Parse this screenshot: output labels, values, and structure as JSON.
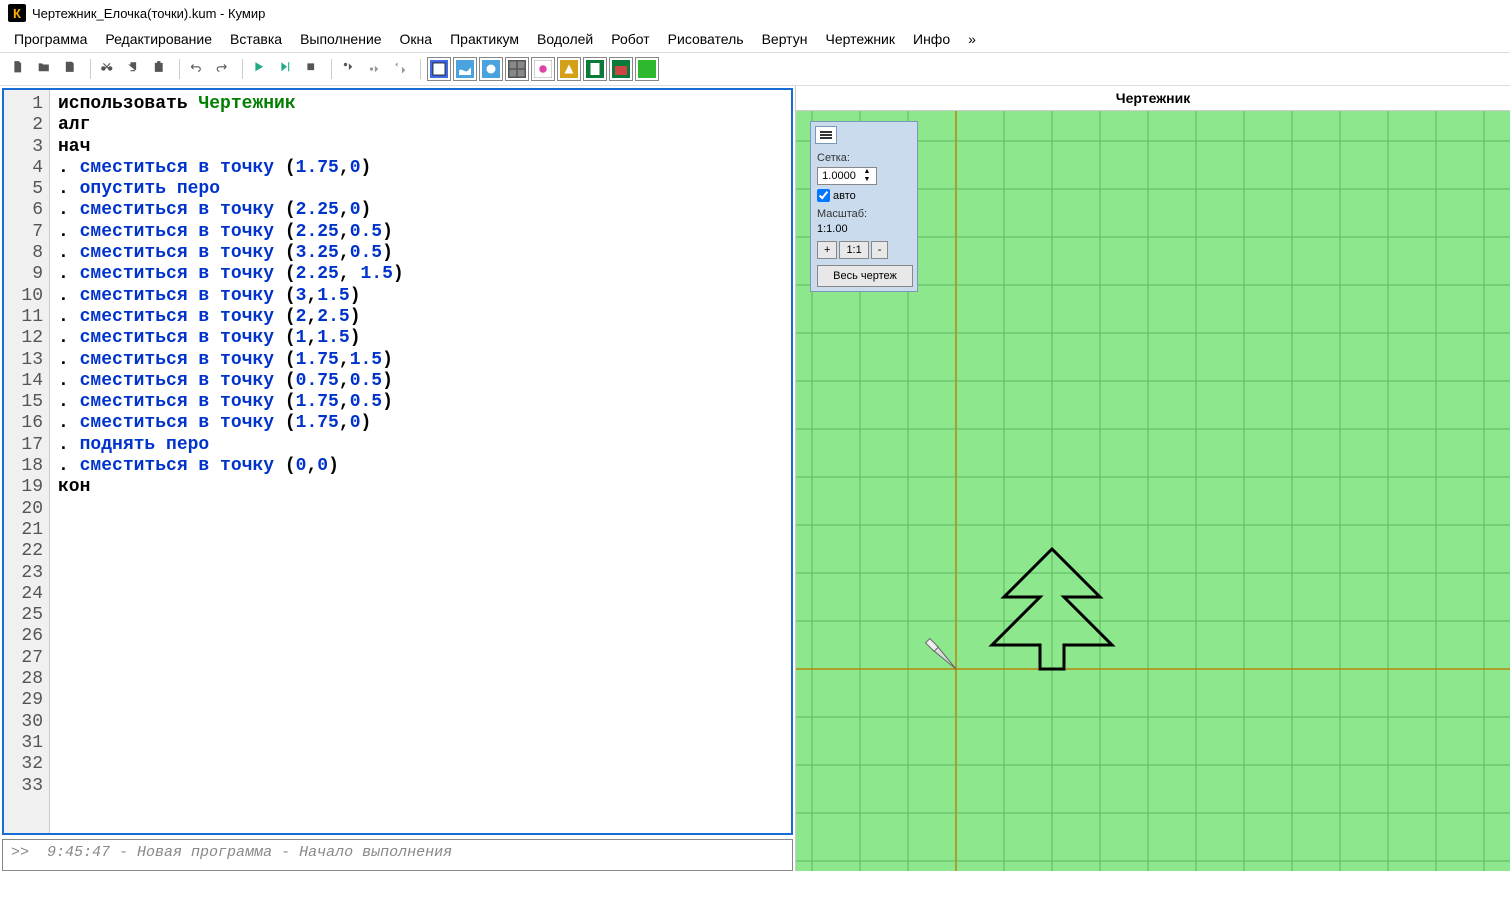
{
  "title": "Чертежник_Елочка(точки).kum - Кумир",
  "menu": [
    "Программа",
    "Редактирование",
    "Вставка",
    "Выполнение",
    "Окна",
    "Практикум",
    "Водолей",
    "Робот",
    "Рисователь",
    "Вертун",
    "Чертежник",
    "Инфо",
    "»"
  ],
  "gutter_max": 33,
  "code_lines": [
    {
      "tokens": [
        {
          "t": "использовать ",
          "c": "kw"
        },
        {
          "t": "Чертежник",
          "c": "mod"
        }
      ]
    },
    {
      "tokens": [
        {
          "t": "алг",
          "c": "kw"
        }
      ]
    },
    {
      "tokens": [
        {
          "t": "нач",
          "c": "kw"
        }
      ]
    },
    {
      "tokens": [
        {
          "t": ". ",
          "c": "dot"
        },
        {
          "t": "сместиться в точку",
          "c": "cmd"
        },
        {
          "t": " (",
          "c": "paren"
        },
        {
          "t": "1.75",
          "c": "num"
        },
        {
          "t": ",",
          "c": "paren"
        },
        {
          "t": "0",
          "c": "num"
        },
        {
          "t": ")",
          "c": "paren"
        }
      ]
    },
    {
      "tokens": [
        {
          "t": ". ",
          "c": "dot"
        },
        {
          "t": "опустить перо",
          "c": "cmd"
        }
      ]
    },
    {
      "tokens": [
        {
          "t": ". ",
          "c": "dot"
        },
        {
          "t": "сместиться в точку",
          "c": "cmd"
        },
        {
          "t": " (",
          "c": "paren"
        },
        {
          "t": "2.25",
          "c": "num"
        },
        {
          "t": ",",
          "c": "paren"
        },
        {
          "t": "0",
          "c": "num"
        },
        {
          "t": ")",
          "c": "paren"
        }
      ]
    },
    {
      "tokens": [
        {
          "t": ". ",
          "c": "dot"
        },
        {
          "t": "сместиться в точку",
          "c": "cmd"
        },
        {
          "t": " (",
          "c": "paren"
        },
        {
          "t": "2.25",
          "c": "num"
        },
        {
          "t": ",",
          "c": "paren"
        },
        {
          "t": "0.5",
          "c": "num"
        },
        {
          "t": ")",
          "c": "paren"
        }
      ]
    },
    {
      "tokens": [
        {
          "t": ". ",
          "c": "dot"
        },
        {
          "t": "сместиться в точку",
          "c": "cmd"
        },
        {
          "t": " (",
          "c": "paren"
        },
        {
          "t": "3.25",
          "c": "num"
        },
        {
          "t": ",",
          "c": "paren"
        },
        {
          "t": "0.5",
          "c": "num"
        },
        {
          "t": ")",
          "c": "paren"
        }
      ]
    },
    {
      "tokens": [
        {
          "t": ". ",
          "c": "dot"
        },
        {
          "t": "сместиться в точку",
          "c": "cmd"
        },
        {
          "t": " (",
          "c": "paren"
        },
        {
          "t": "2.25",
          "c": "num"
        },
        {
          "t": ", ",
          "c": "paren"
        },
        {
          "t": "1.5",
          "c": "num"
        },
        {
          "t": ")",
          "c": "paren"
        }
      ]
    },
    {
      "tokens": [
        {
          "t": ". ",
          "c": "dot"
        },
        {
          "t": "сместиться в точку",
          "c": "cmd"
        },
        {
          "t": " (",
          "c": "paren"
        },
        {
          "t": "3",
          "c": "num"
        },
        {
          "t": ",",
          "c": "paren"
        },
        {
          "t": "1.5",
          "c": "num"
        },
        {
          "t": ")",
          "c": "paren"
        }
      ]
    },
    {
      "tokens": [
        {
          "t": ". ",
          "c": "dot"
        },
        {
          "t": "сместиться в точку",
          "c": "cmd"
        },
        {
          "t": " (",
          "c": "paren"
        },
        {
          "t": "2",
          "c": "num"
        },
        {
          "t": ",",
          "c": "paren"
        },
        {
          "t": "2.5",
          "c": "num"
        },
        {
          "t": ")",
          "c": "paren"
        }
      ]
    },
    {
      "tokens": [
        {
          "t": ". ",
          "c": "dot"
        },
        {
          "t": "сместиться в точку",
          "c": "cmd"
        },
        {
          "t": " (",
          "c": "paren"
        },
        {
          "t": "1",
          "c": "num"
        },
        {
          "t": ",",
          "c": "paren"
        },
        {
          "t": "1.5",
          "c": "num"
        },
        {
          "t": ")",
          "c": "paren"
        }
      ]
    },
    {
      "tokens": [
        {
          "t": ". ",
          "c": "dot"
        },
        {
          "t": "сместиться в точку",
          "c": "cmd"
        },
        {
          "t": " (",
          "c": "paren"
        },
        {
          "t": "1.75",
          "c": "num"
        },
        {
          "t": ",",
          "c": "paren"
        },
        {
          "t": "1.5",
          "c": "num"
        },
        {
          "t": ")",
          "c": "paren"
        }
      ]
    },
    {
      "tokens": [
        {
          "t": ". ",
          "c": "dot"
        },
        {
          "t": "сместиться в точку",
          "c": "cmd"
        },
        {
          "t": " (",
          "c": "paren"
        },
        {
          "t": "0.75",
          "c": "num"
        },
        {
          "t": ",",
          "c": "paren"
        },
        {
          "t": "0.5",
          "c": "num"
        },
        {
          "t": ")",
          "c": "paren"
        }
      ]
    },
    {
      "tokens": [
        {
          "t": ". ",
          "c": "dot"
        },
        {
          "t": "сместиться в точку",
          "c": "cmd"
        },
        {
          "t": " (",
          "c": "paren"
        },
        {
          "t": "1.75",
          "c": "num"
        },
        {
          "t": ",",
          "c": "paren"
        },
        {
          "t": "0.5",
          "c": "num"
        },
        {
          "t": ")",
          "c": "paren"
        }
      ]
    },
    {
      "tokens": [
        {
          "t": ". ",
          "c": "dot"
        },
        {
          "t": "сместиться в точку",
          "c": "cmd"
        },
        {
          "t": " (",
          "c": "paren"
        },
        {
          "t": "1.75",
          "c": "num"
        },
        {
          "t": ",",
          "c": "paren"
        },
        {
          "t": "0",
          "c": "num"
        },
        {
          "t": ")",
          "c": "paren"
        }
      ]
    },
    {
      "tokens": [
        {
          "t": ". ",
          "c": "dot"
        },
        {
          "t": "поднять перо",
          "c": "cmd"
        }
      ]
    },
    {
      "tokens": [
        {
          "t": ". ",
          "c": "dot"
        },
        {
          "t": "сместиться в точку",
          "c": "cmd"
        },
        {
          "t": " (",
          "c": "paren"
        },
        {
          "t": "0",
          "c": "num"
        },
        {
          "t": ",",
          "c": "paren"
        },
        {
          "t": "0",
          "c": "num"
        },
        {
          "t": ")",
          "c": "paren"
        }
      ]
    },
    {
      "tokens": [
        {
          "t": "кон",
          "c": "kw"
        }
      ]
    }
  ],
  "console_prompt": ">>",
  "console_text": "9:45:47 - Новая программа - Начало выполнения",
  "canvas": {
    "title": "Чертежник",
    "grid_label": "Сетка:",
    "grid_value": "1.0000",
    "auto_label": "авто",
    "scale_label": "Масштаб:",
    "scale_value": "1:1.00",
    "zoom_in": "+",
    "zoom_11": "1:1",
    "zoom_out": "-",
    "full_drawing": "Весь чертеж"
  },
  "toolbar_icons": [
    "new-file",
    "open-file",
    "save-file",
    "cut",
    "copy",
    "paste",
    "undo",
    "redo",
    "run",
    "run-step",
    "stop",
    "step-into",
    "step-over",
    "step-out",
    "pict-tool",
    "vodoley-tool",
    "robot-tool",
    "draw-tool",
    "turtle-tool",
    "cherteznik-tool",
    "field1-tool",
    "field2-tool",
    "field3-tool"
  ],
  "tree_points": [
    [
      1.75,
      0
    ],
    [
      2.25,
      0
    ],
    [
      2.25,
      0.5
    ],
    [
      3.25,
      0.5
    ],
    [
      2.25,
      1.5
    ],
    [
      3,
      1.5
    ],
    [
      2,
      2.5
    ],
    [
      1,
      1.5
    ],
    [
      1.75,
      1.5
    ],
    [
      0.75,
      0.5
    ],
    [
      1.75,
      0.5
    ],
    [
      1.75,
      0
    ]
  ]
}
